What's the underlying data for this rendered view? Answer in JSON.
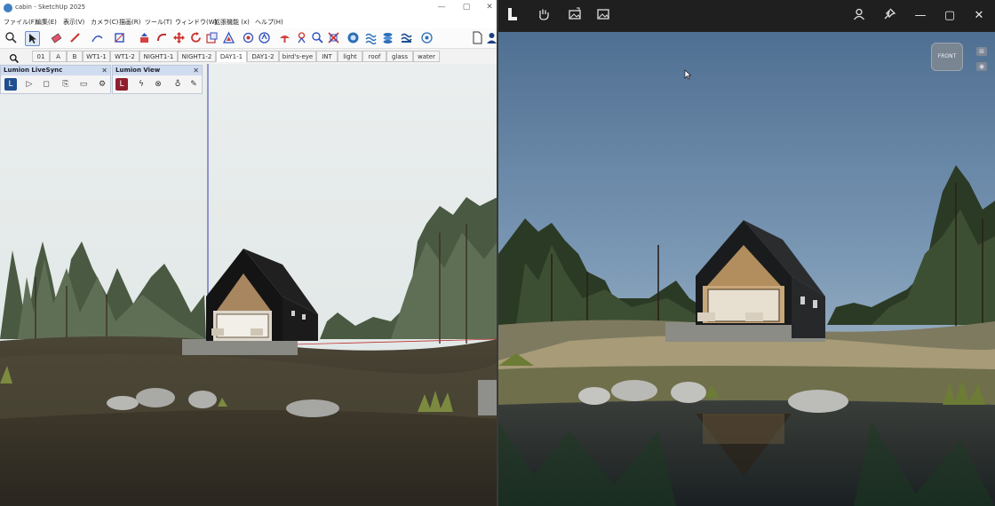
{
  "sketchup": {
    "title": "cabin - SketchUp 2025",
    "window_controls": [
      "—",
      "▢",
      "✕"
    ],
    "menu": [
      "ファイル(F)",
      "編集(E)",
      "表示(V)",
      "カメラ(C)",
      "描画(R)",
      "ツール(T)",
      "ウィンドウ(W)",
      "拡張機能 (x)",
      "ヘルプ(H)"
    ],
    "tabs": [
      "01",
      "A",
      "B",
      "WT1-1",
      "WT1-2",
      "NIGHT1-1",
      "NIGHT1-2",
      "DAY1-1",
      "DAY1-2",
      "bird's-eye",
      "INT",
      "light",
      "roof",
      "glass",
      "water"
    ],
    "active_tab": "DAY1-1",
    "colors": {
      "accent": "#1f4f8f",
      "tab_active": "#ffffff"
    }
  },
  "livesync_panel": {
    "title": "Lumion LiveSync",
    "close": "✕",
    "buttons": [
      "lumion-logo-icon",
      "play-icon",
      "stop-icon",
      "record-camera-icon",
      "video-camera-icon",
      "settings-icon"
    ]
  },
  "view_panel": {
    "title": "Lumion View",
    "close": "✕",
    "buttons": [
      "lumion-logo-icon",
      "lightning-icon",
      "target-icon",
      "bulb-icon",
      "brush-icon"
    ]
  },
  "lumion": {
    "toolbar_icons": [
      "lumion-logo-icon",
      "hand-icon",
      "image-export-icon",
      "image-icon",
      "user-icon",
      "pin-icon"
    ],
    "window_controls": [
      "—",
      "▢",
      "✕"
    ],
    "view_cube_label": "FRONT"
  }
}
